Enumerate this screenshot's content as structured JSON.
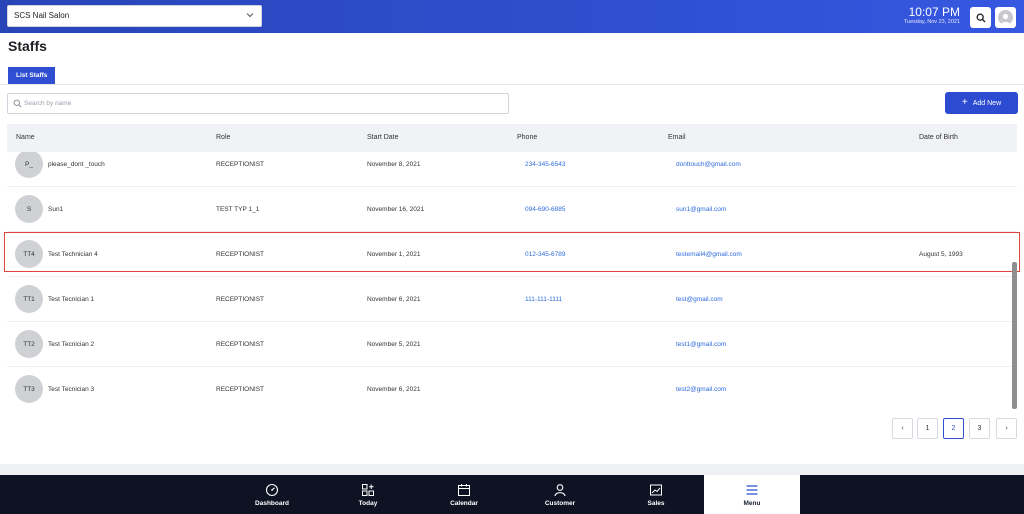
{
  "header": {
    "store_name": "SCS Nail Salon",
    "time": "10:07 PM",
    "date": "Tuesday, Nov 23, 2021"
  },
  "page": {
    "title": "Staffs",
    "tab": "List Staffs",
    "search_placeholder": "Search by name",
    "add_new_label": "Add New"
  },
  "table": {
    "columns": [
      "Name",
      "Role",
      "Start Date",
      "Phone",
      "Email",
      "Date of Birth"
    ],
    "rows": [
      {
        "initials": "P_",
        "name": "please_dont _touch",
        "role": "RECEPTIONIST",
        "start": "November 8, 2021",
        "phone": "234-345-6543",
        "email": "donttouch@gmail.com",
        "dob": ""
      },
      {
        "initials": "S",
        "name": "Sun1",
        "role": "TEST TYP 1_1",
        "start": "November 16, 2021",
        "phone": "094-690-6885",
        "email": "sun1@gmail.com",
        "dob": ""
      },
      {
        "initials": "TT4",
        "name": "Test Technician 4",
        "role": "RECEPTIONIST",
        "start": "November 1, 2021",
        "phone": "012-345-6789",
        "email": "testemail4@gmail.com",
        "dob": "August 5, 1993"
      },
      {
        "initials": "TT1",
        "name": "Test Tecnician 1",
        "role": "RECEPTIONIST",
        "start": "November 6, 2021",
        "phone": "111-111-1111",
        "email": "test@gmail.com",
        "dob": ""
      },
      {
        "initials": "TT2",
        "name": "Test Tecnician 2",
        "role": "RECEPTIONIST",
        "start": "November 5, 2021",
        "phone": "",
        "email": "test1@gmail.com",
        "dob": ""
      },
      {
        "initials": "TT3",
        "name": "Test Tecnician 3",
        "role": "RECEPTIONIST",
        "start": "November 6, 2021",
        "phone": "",
        "email": "test2@gmail.com",
        "dob": ""
      }
    ]
  },
  "pagination": {
    "prev": "‹",
    "pages": [
      "1",
      "2",
      "3"
    ],
    "current": "2",
    "next": "›"
  },
  "bottom_nav": {
    "items": [
      {
        "label": "Dashboard",
        "icon": "gauge-icon"
      },
      {
        "label": "Today",
        "icon": "grid-plus-icon"
      },
      {
        "label": "Calendar",
        "icon": "calendar-icon"
      },
      {
        "label": "Customer",
        "icon": "person-icon"
      },
      {
        "label": "Sales",
        "icon": "chart-icon"
      },
      {
        "label": "Menu",
        "icon": "hamburger-icon"
      }
    ],
    "active": "Menu"
  },
  "colors": {
    "primary": "#2f4ed1",
    "link": "#2e6bdc",
    "nav_bg": "#0d1322",
    "highlight": "#e0453c"
  }
}
